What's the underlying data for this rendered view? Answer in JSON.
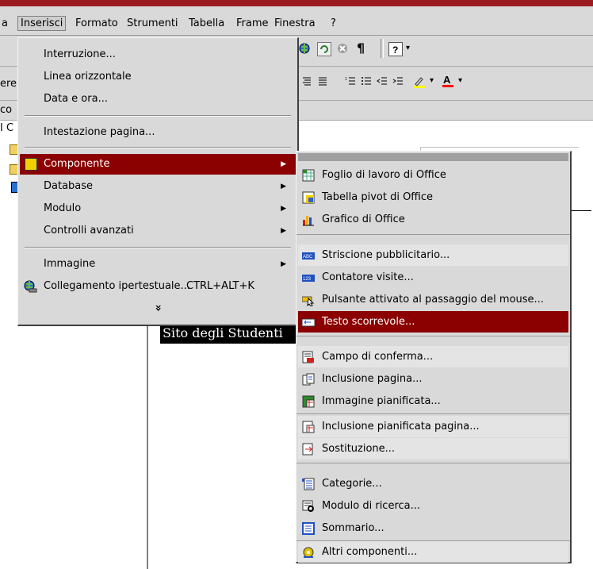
{
  "menubar": {
    "items": [
      "a",
      "Inserisci",
      "Formato",
      "Strumenti",
      "Tabella",
      "Frame",
      "Finestra",
      "?"
    ]
  },
  "toolbar_fragments": {
    "r1": "ere",
    "r2": "co",
    "r3": "I C"
  },
  "page_text": "Sito degli Studenti",
  "insert_menu": {
    "items": [
      {
        "label": "Interruzione..."
      },
      {
        "label": "Linea orizzontale"
      },
      {
        "label": "Data e ora..."
      },
      {
        "label": "Intestazione pagina..."
      },
      {
        "label": "Componente",
        "submenu": true,
        "highlighted": true
      },
      {
        "label": "Database",
        "submenu": true
      },
      {
        "label": "Modulo",
        "submenu": true
      },
      {
        "label": "Controlli avanzati",
        "submenu": true
      },
      {
        "label": "Immagine",
        "submenu": true
      },
      {
        "label": "Collegamento ipertestuale...",
        "shortcut": "CTRL+ALT+K"
      }
    ],
    "expand_glyph": "»"
  },
  "component_submenu": {
    "items": [
      {
        "label": "Foglio di lavoro di Office",
        "icon": "spreadsheet-icon"
      },
      {
        "label": "Tabella pivot di Office",
        "icon": "pivot-table-icon"
      },
      {
        "label": "Grafico di Office",
        "icon": "chart-icon"
      },
      {
        "label": "Striscione pubblicitario...",
        "icon": "banner-icon"
      },
      {
        "label": "Contatore visite...",
        "icon": "counter-icon"
      },
      {
        "label": "Pulsante attivato al passaggio del mouse...",
        "icon": "hover-button-icon"
      },
      {
        "label": "Testo scorrevole...",
        "icon": "marquee-icon",
        "highlighted": true
      },
      {
        "label": "Campo di conferma...",
        "icon": "confirmation-field-icon"
      },
      {
        "label": "Inclusione pagina...",
        "icon": "include-page-icon"
      },
      {
        "label": "Immagine pianificata...",
        "icon": "scheduled-picture-icon"
      },
      {
        "label": "Inclusione pianificata pagina...",
        "icon": "scheduled-include-icon"
      },
      {
        "label": "Sostituzione...",
        "icon": "substitution-icon"
      },
      {
        "label": "Categorie...",
        "icon": "categories-icon"
      },
      {
        "label": "Modulo di ricerca...",
        "icon": "search-form-icon"
      },
      {
        "label": "Sommario...",
        "icon": "table-of-contents-icon"
      },
      {
        "label": "Altri componenti...",
        "icon": "other-components-icon"
      }
    ]
  },
  "colors": {
    "highlight": "#8b0000",
    "menu_bg": "#d9d9d9",
    "top_bar": "#9b1c20"
  }
}
